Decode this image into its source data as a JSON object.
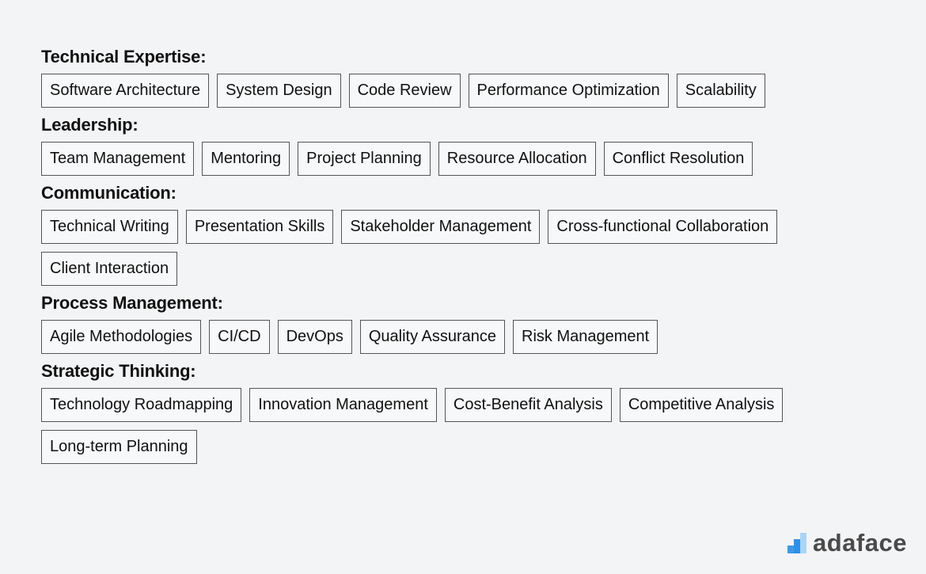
{
  "sections": [
    {
      "title": "Technical Expertise:",
      "tags": [
        "Software Architecture",
        "System Design",
        "Code Review",
        "Performance Optimization",
        "Scalability"
      ]
    },
    {
      "title": "Leadership:",
      "tags": [
        "Team Management",
        "Mentoring",
        "Project Planning",
        "Resource Allocation",
        "Conflict Resolution"
      ]
    },
    {
      "title": "Communication:",
      "tags": [
        "Technical Writing",
        "Presentation Skills",
        "Stakeholder Management",
        "Cross-functional Collaboration",
        "Client Interaction"
      ]
    },
    {
      "title": "Process Management:",
      "tags": [
        "Agile Methodologies",
        "CI/CD",
        "DevOps",
        "Quality Assurance",
        "Risk Management"
      ]
    },
    {
      "title": "Strategic Thinking:",
      "tags": [
        "Technology Roadmapping",
        "Innovation Management",
        "Cost-Benefit Analysis",
        "Competitive Analysis",
        "Long-term Planning"
      ]
    }
  ],
  "logo": {
    "text": "adaface",
    "icon": "bar-steps-icon",
    "color": "#2f8fe8"
  }
}
